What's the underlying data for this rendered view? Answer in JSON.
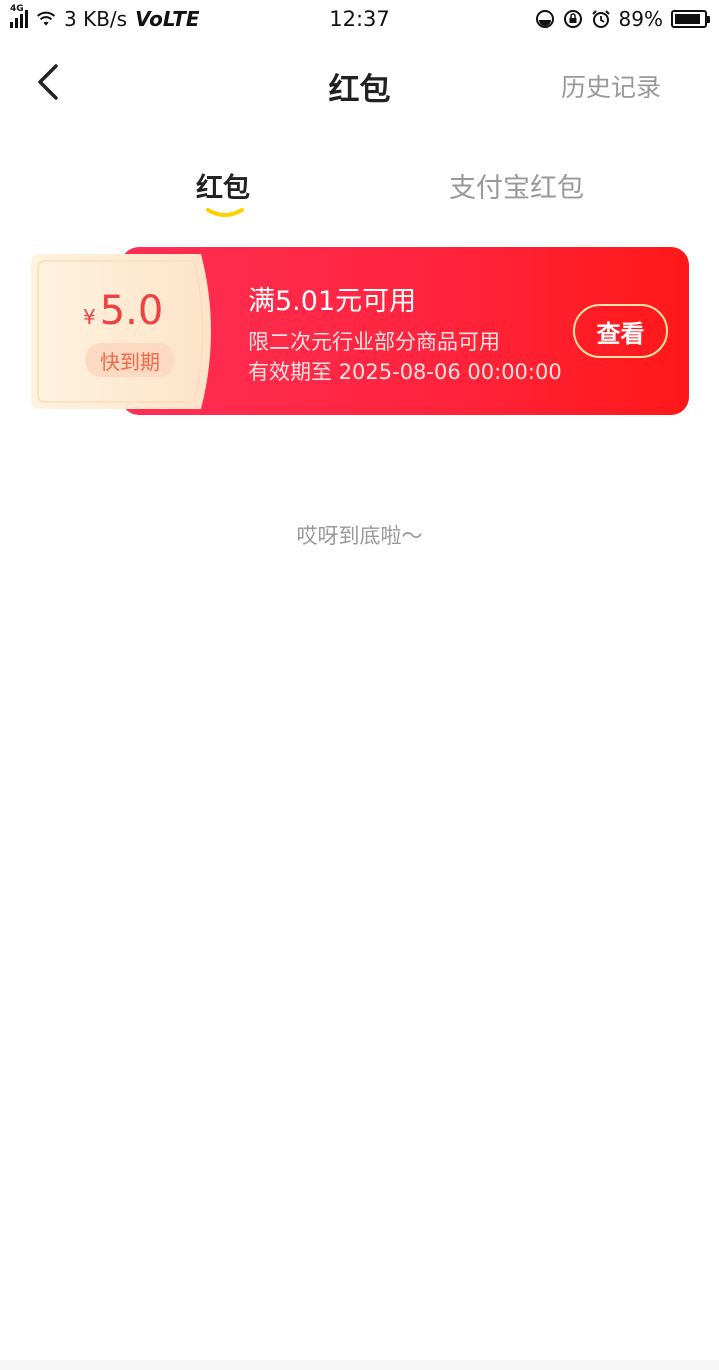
{
  "status_bar": {
    "network_type": "4G",
    "speed": "3 KB/s",
    "volte": "VoLTE",
    "time": "12:37",
    "battery_percent_text": "89%",
    "battery_level": 0.89,
    "icons": [
      "signal-icon",
      "wifi-icon",
      "data-saver-icon",
      "rotation-lock-icon",
      "alarm-icon",
      "battery-icon"
    ]
  },
  "nav": {
    "title": "红包",
    "history_label": "历史记录",
    "back_icon": "chevron-left-icon"
  },
  "tabs": [
    {
      "label": "红包",
      "active": true
    },
    {
      "label": "支付宝红包",
      "active": false
    }
  ],
  "colors": {
    "accent_red": "#ff1e3c",
    "amount_red": "#f04040",
    "tab_underline": "#ffd000",
    "muted": "#999999"
  },
  "coupons": [
    {
      "currency": "¥",
      "amount": "5.0",
      "badge": "快到期",
      "title": "满5.01元可用",
      "desc": "限二次元行业部分商品可用",
      "validity": "有效期至 2025-08-06 00:00:00",
      "action_label": "查看"
    }
  ],
  "footer_text": "哎呀到底啦～"
}
